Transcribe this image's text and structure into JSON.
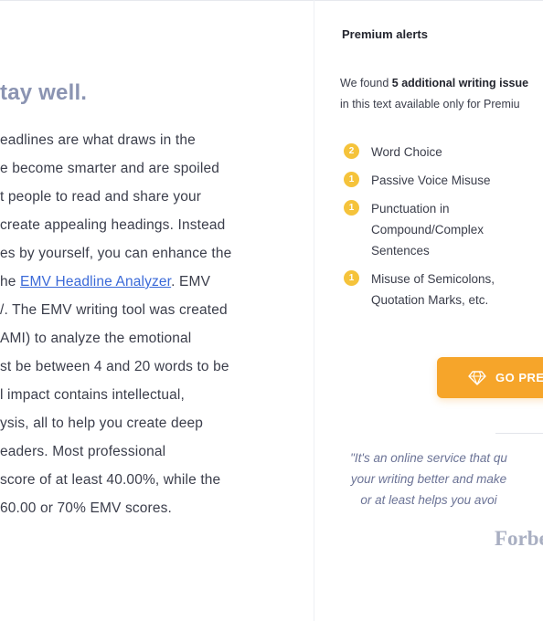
{
  "article": {
    "heading": "tay well.",
    "lines": [
      {
        "text": "eadlines are what draws in the"
      },
      {
        "text": "e become smarter and are spoiled"
      },
      {
        "text": "t people to read and share your"
      },
      {
        "text": "create appealing headings. Instead"
      },
      {
        "text": "es by yourself, you can enhance the"
      },
      {
        "before": "he ",
        "link": "EMV Headline Analyzer",
        "after": ". EMV"
      },
      {
        "text": "/. The  EMV writing tool was created"
      },
      {
        "text": "AMI) to analyze the emotional"
      },
      {
        "text": "st be between 4 and 20 words to be"
      },
      {
        "text": "l impact contains intellectual,"
      },
      {
        "text": "ysis, all to help you create deep"
      },
      {
        "text": "eaders. Most professional"
      },
      {
        "text": "score of at least 40.00%, while the"
      },
      {
        "text": "60.00 or 70% EMV scores."
      }
    ]
  },
  "panel": {
    "title": "Premium alerts",
    "intro_prefix": "We found ",
    "intro_bold": "5 additional writing issue",
    "intro_line2": "in this text available only for Premiu",
    "issues": [
      {
        "count": "2",
        "label": "Word Choice"
      },
      {
        "count": "1",
        "label": "Passive Voice Misuse"
      },
      {
        "count": "1",
        "label": "Punctuation in\nCompound/Complex\nSentences"
      },
      {
        "count": "1",
        "label": "Misuse of Semicolons,\nQuotation Marks, etc."
      }
    ],
    "button_label": "GO PREI",
    "button_icon": "diamond-icon",
    "quote_lines": [
      "\"It's an online service that qu",
      "your writing better and make",
      "or at least helps you avoi"
    ],
    "source": "Forbe"
  },
  "colors": {
    "accent": "#f6a52a",
    "badge": "#f5c33b",
    "heading": "#8b94b2",
    "link": "#3b6ad8"
  }
}
